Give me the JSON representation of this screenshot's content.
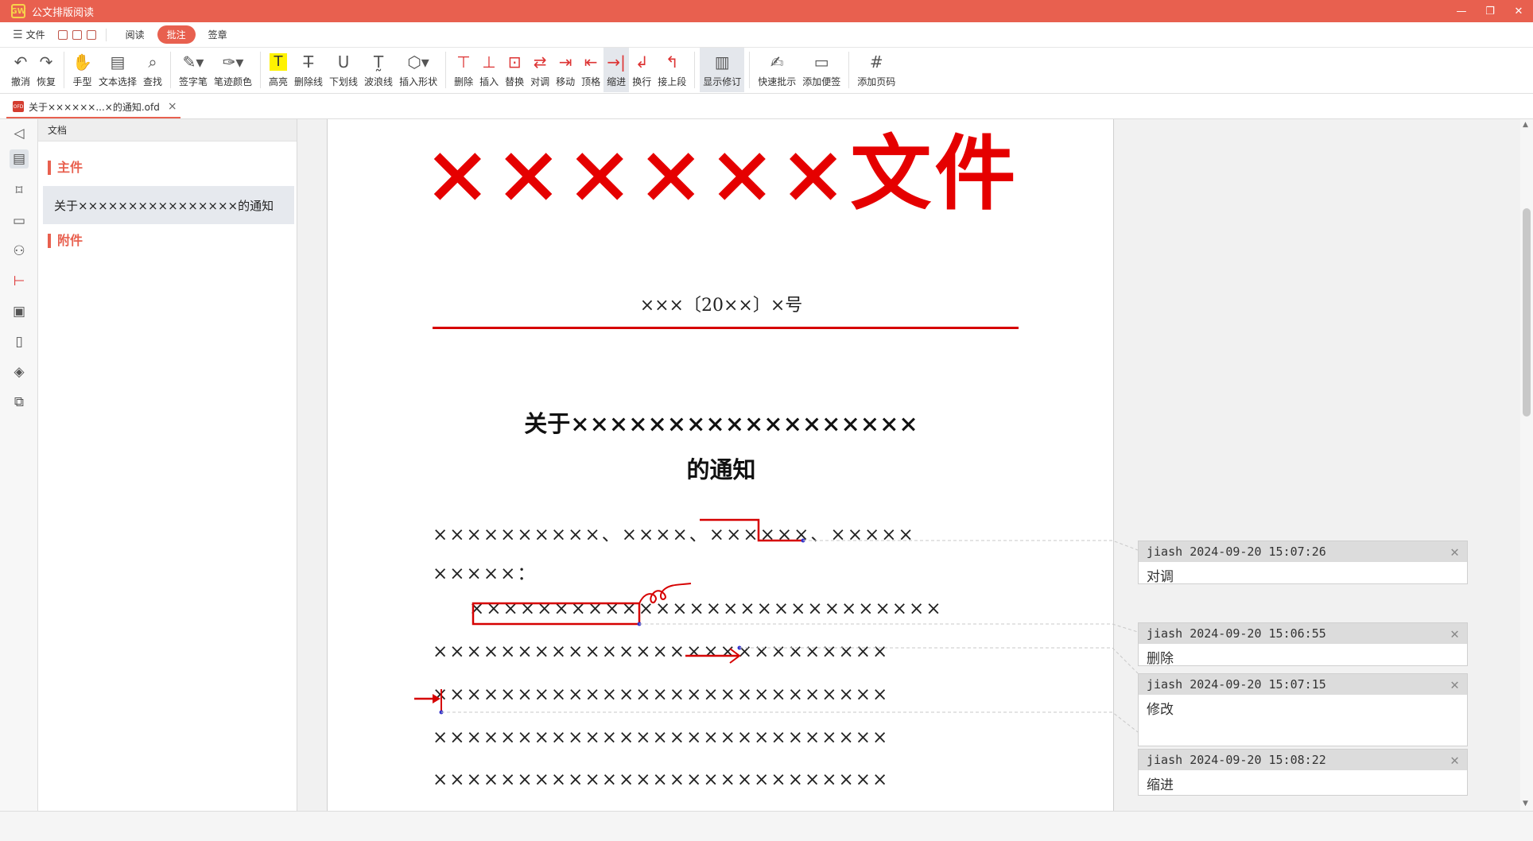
{
  "app": {
    "title": "公文排版阅读",
    "logo_text": "GW"
  },
  "window_controls": {
    "minimize": "—",
    "restore": "❐",
    "close": "✕"
  },
  "menu": {
    "file_label": "文件",
    "tabs": [
      "阅读",
      "批注",
      "签章"
    ]
  },
  "toolbar": {
    "undo": "撤消",
    "redo": "恢复",
    "hand": "手型",
    "text_select": "文本选择",
    "find": "查找",
    "sign_pen": "签字笔",
    "pen_color": "笔迹颜色",
    "highlight": "高亮",
    "strike": "删除线",
    "underline": "下划线",
    "wave": "波浪线",
    "shape": "插入形状",
    "delete": "删除",
    "insert": "插入",
    "replace": "替换",
    "swap": "对调",
    "move": "移动",
    "top": "顶格",
    "indent": "缩进",
    "newline": "换行",
    "join": "接上段",
    "show_rev": "显示修订",
    "quick_comment": "快速批示",
    "add_note": "添加便签",
    "add_page_no": "添加页码"
  },
  "doc_tab": {
    "label": "关于××××××...×的通知.ofd",
    "type": "OFD"
  },
  "outline": {
    "header": "文档",
    "main_section": "主件",
    "main_item": "关于××××××××××××××××的通知",
    "attach_section": "附件"
  },
  "document": {
    "red_title": "××××××文件",
    "doc_number": "×××〔20××〕×号",
    "heading_line1": "关于××××××××××××××××××",
    "heading_line2": "的通知",
    "para_lines": [
      "××××××××××、××××、××××××、×××××",
      "×××××：",
      "××××××××××××××××××××××××××××",
      "×××××××××××××××××××××××××××",
      "×××××××××××××××××××××××××××",
      "×××××××××××××××××××××××××××",
      "×××××××××××××××××××××××××××"
    ]
  },
  "comments": [
    {
      "author": "jiash",
      "time": "2024-09-20 15:07:26",
      "text": "对调"
    },
    {
      "author": "jiash",
      "time": "2024-09-20 15:06:55",
      "text": "删除"
    },
    {
      "author": "jiash",
      "time": "2024-09-20 15:07:15",
      "text": "修改"
    },
    {
      "author": "jiash",
      "time": "2024-09-20 15:08:22",
      "text": "缩进"
    }
  ],
  "colors": {
    "accent": "#e8604f",
    "red_title": "#e50000",
    "mark": "#d60000",
    "mark_point": "#3333cc"
  }
}
